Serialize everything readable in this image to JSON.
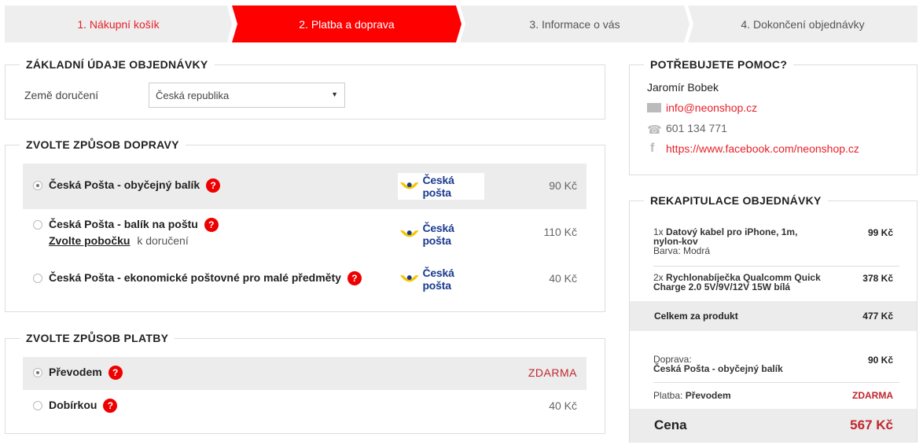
{
  "steps": [
    "1. Nákupní košík",
    "2. Platba a doprava",
    "3. Informace o vás",
    "4. Dokončení objednávky"
  ],
  "basic": {
    "title": "ZÁKLADNÍ ÚDAJE OBJEDNÁVKY",
    "country_label": "Země doručení",
    "country_value": "Česká republika"
  },
  "shipping": {
    "title": "ZVOLTE ZPŮSOB DOPRAVY",
    "options": [
      {
        "label": "Česká Pošta - obyčejný balík",
        "price": "90 Kč",
        "logo": "Česká pošta"
      },
      {
        "label": "Česká Pošta - balík na poštu",
        "link": "Zvolte pobočku",
        "link_suffix": "k doručení",
        "price": "110 Kč",
        "logo": "Česká pošta"
      },
      {
        "label": "Česká Pošta - ekonomické poštovné pro malé předměty",
        "price": "40 Kč",
        "logo": "Česká pošta"
      }
    ]
  },
  "payment": {
    "title": "ZVOLTE ZPŮSOB PLATBY",
    "options": [
      {
        "label": "Převodem",
        "price": "ZDARMA"
      },
      {
        "label": "Dobírkou",
        "price": "40 Kč"
      }
    ]
  },
  "help": {
    "title": "POTŘEBUJETE POMOC?",
    "name": "Jaromír Bobek",
    "email": "info@neonshop.cz",
    "phone": "601 134 771",
    "facebook": "https://www.facebook.com/neonshop.cz"
  },
  "recap": {
    "title": "REKAPITULACE OBJEDNÁVKY",
    "items": [
      {
        "qty": "1x",
        "name": "Datový kabel pro iPhone, 1m,",
        "name2": "nylon-kov",
        "variant": "Barva: Modrá",
        "price": "99 Kč"
      },
      {
        "qty": "2x",
        "name": "Rychlonabíječka Qualcomm Quick",
        "name2": "Charge 2.0 5V/9V/12V 15W bílá",
        "price": "378 Kč"
      }
    ],
    "subtotal_label": "Celkem za produkt",
    "subtotal": "477 Kč",
    "shipping_label": "Doprava:",
    "shipping_name": "Česká Pošta - obyčejný balík",
    "shipping_price": "90 Kč",
    "payment_label": "Platba:",
    "payment_name": "Převodem",
    "payment_price": "ZDARMA",
    "total_label": "Cena",
    "total": "567 Kč"
  },
  "colors": {
    "accent": "#ff0000",
    "link": "#e8202a",
    "logo_yellow": "#f7c600",
    "logo_blue": "#1a3a8f"
  }
}
